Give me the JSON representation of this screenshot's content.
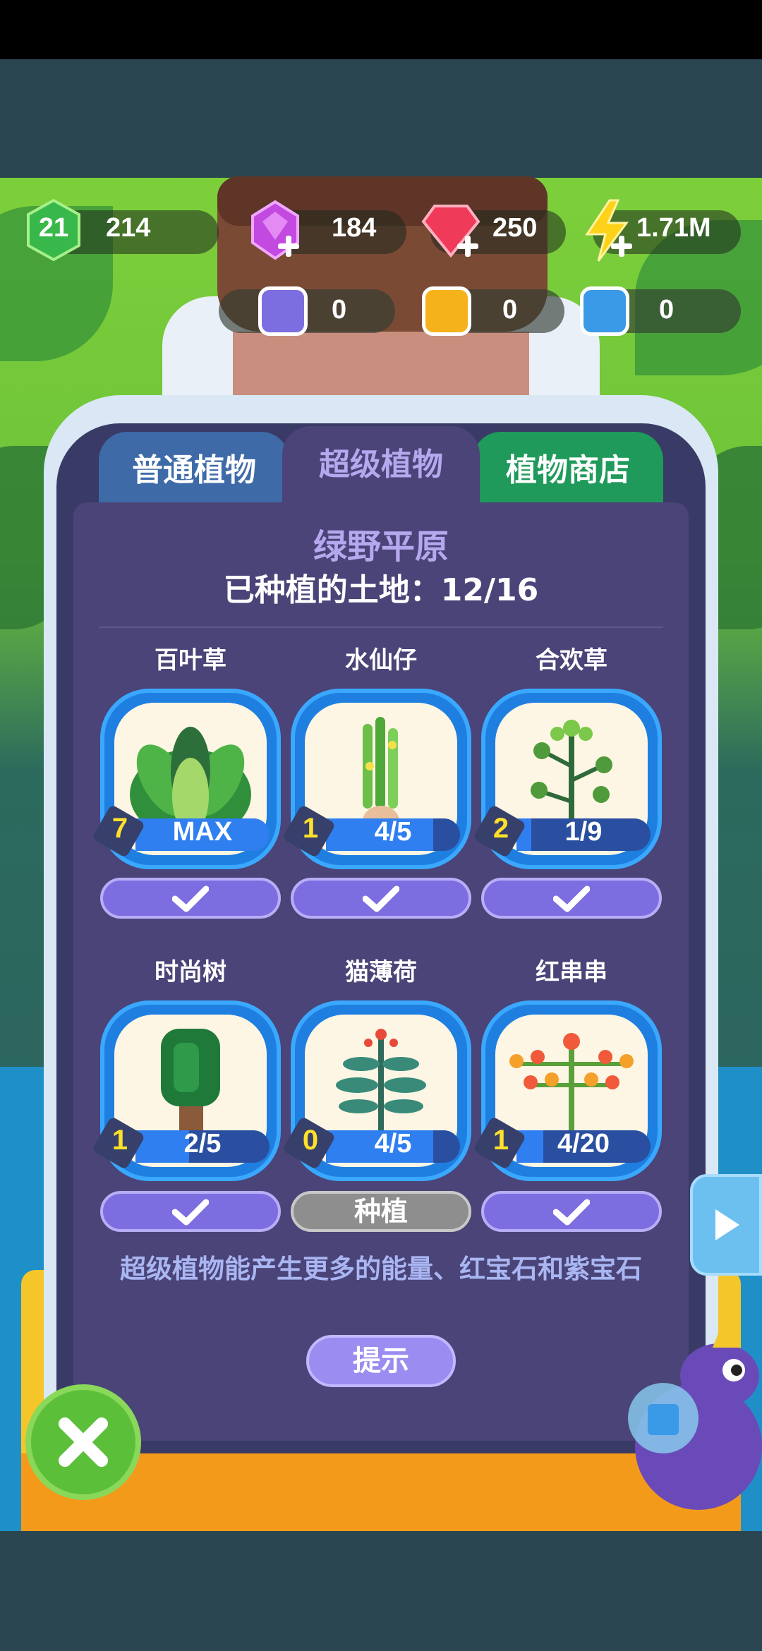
{
  "resources": {
    "level": "21",
    "xp": "214",
    "purple_gems": "184",
    "red_gems": "250",
    "energy": "1.71M"
  },
  "seeds": {
    "purple": "0",
    "gold": "0",
    "blue": "0"
  },
  "tabs": [
    {
      "label": "普通植物",
      "active": false
    },
    {
      "label": "超级植物",
      "active": true
    },
    {
      "label": "植物商店",
      "active": false
    }
  ],
  "region": {
    "name": "绿野平原",
    "land_label": "已种植的土地：12/16"
  },
  "plants": [
    {
      "name": "百叶草",
      "level": "7",
      "progress": "MAX",
      "fill": 1.0,
      "action": "check"
    },
    {
      "name": "水仙仔",
      "level": "1",
      "progress": "4/5",
      "fill": 0.8,
      "action": "check"
    },
    {
      "name": "合欢草",
      "level": "2",
      "progress": "1/9",
      "fill": 0.11,
      "action": "check"
    },
    {
      "name": "时尚树",
      "level": "1",
      "progress": "2/5",
      "fill": 0.4,
      "action": "check"
    },
    {
      "name": "猫薄荷",
      "level": "0",
      "progress": "4/5",
      "fill": 0.8,
      "action": "种植"
    },
    {
      "name": "红串串",
      "level": "1",
      "progress": "4/20",
      "fill": 0.2,
      "action": "check"
    }
  ],
  "hint": {
    "text": "超级植物能产生更多的能量、红宝石和紫宝石",
    "button": "提示"
  },
  "icons": {
    "close": "close-icon",
    "next": "play-arrow-icon"
  }
}
